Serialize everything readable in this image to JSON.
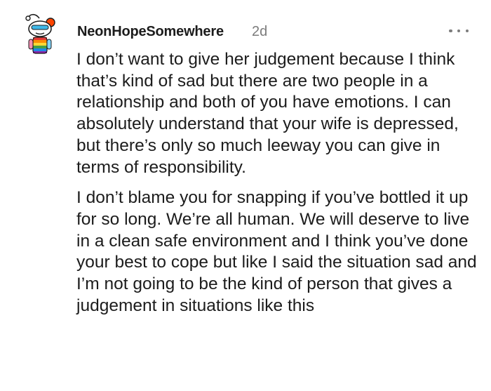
{
  "comment": {
    "author": "NeonHopeSomewhere",
    "age": "2d",
    "paragraphs": [
      "I don’t want to give her judgement because I think that’s kind of sad but there are two people in a relationship and both of you have emotions. I can absolutely understand that your wife is depressed, but there’s only so much leeway you can give in terms of responsibility.",
      "I don’t blame you for snapping if you’ve bottled it up for so long. We’re all human. We will deserve to live in a clean safe environment and I think you’ve done your best to cope but like I said the situation sad and I’m not going to be the kind of person that gives a judgement in situations like this"
    ]
  },
  "icons": {
    "avatar": "snoo-avatar-icon",
    "more": "more-options-icon"
  },
  "colors": {
    "text": "#1c1c1c",
    "meta": "#7c7c7c",
    "background": "#ffffff"
  }
}
